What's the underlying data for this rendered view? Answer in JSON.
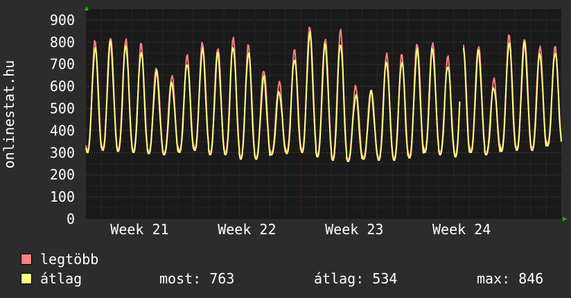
{
  "chart_data": {
    "type": "line",
    "ylabel": "onlinestat.hu",
    "ylim": [
      0,
      950
    ],
    "yticks": [
      0,
      100,
      200,
      300,
      400,
      500,
      600,
      700,
      800,
      900
    ],
    "xlim": [
      0,
      31
    ],
    "week_labels": [
      {
        "label": "Week 21",
        "x": 3.5
      },
      {
        "label": "Week 22",
        "x": 10.5
      },
      {
        "label": "Week 23",
        "x": 17.5
      },
      {
        "label": "Week 24",
        "x": 24.5
      }
    ],
    "week_boundaries": [
      7,
      14,
      21,
      28
    ],
    "grid": true,
    "series": [
      {
        "name": "legtöbb",
        "color": "#ff7f7f",
        "daily_peaks": [
          805,
          830,
          810,
          790,
          690,
          650,
          735,
          800,
          780,
          815,
          785,
          680,
          620,
          760,
          875,
          820,
          850,
          600,
          590,
          745,
          740,
          800,
          800,
          730,
          800,
          790,
          630,
          830,
          825,
          780,
          775
        ],
        "daily_mins": [
          310,
          320,
          315,
          310,
          305,
          300,
          310,
          320,
          300,
          300,
          280,
          280,
          300,
          305,
          310,
          290,
          275,
          270,
          280,
          275,
          275,
          285,
          310,
          300,
          290,
          310,
          300,
          315,
          320,
          320,
          340
        ]
      },
      {
        "name": "átlag",
        "color": "#ffff80",
        "daily_peaks": [
          775,
          800,
          790,
          760,
          665,
          615,
          710,
          770,
          750,
          785,
          755,
          640,
          575,
          730,
          840,
          790,
          800,
          560,
          575,
          715,
          715,
          765,
          770,
          700,
          770,
          760,
          600,
          800,
          795,
          750,
          760
        ],
        "daily_mins": [
          300,
          310,
          305,
          300,
          295,
          290,
          300,
          310,
          290,
          290,
          270,
          270,
          290,
          295,
          300,
          280,
          265,
          260,
          270,
          265,
          265,
          275,
          300,
          290,
          280,
          300,
          290,
          305,
          310,
          310,
          330
        ]
      }
    ],
    "gap_day": 24
  },
  "legend": {
    "max_label": "legtöbb",
    "avg_label": "átlag"
  },
  "stats": {
    "current": "most: 763",
    "average": "átlag: 534",
    "maximum": "max: 846"
  },
  "colors": {
    "background": "#2c2c2c",
    "plot_background": "#1a1a1a",
    "grid": "#444444",
    "week_line": "#7a2222",
    "axis_arrow": "#00cc00"
  }
}
